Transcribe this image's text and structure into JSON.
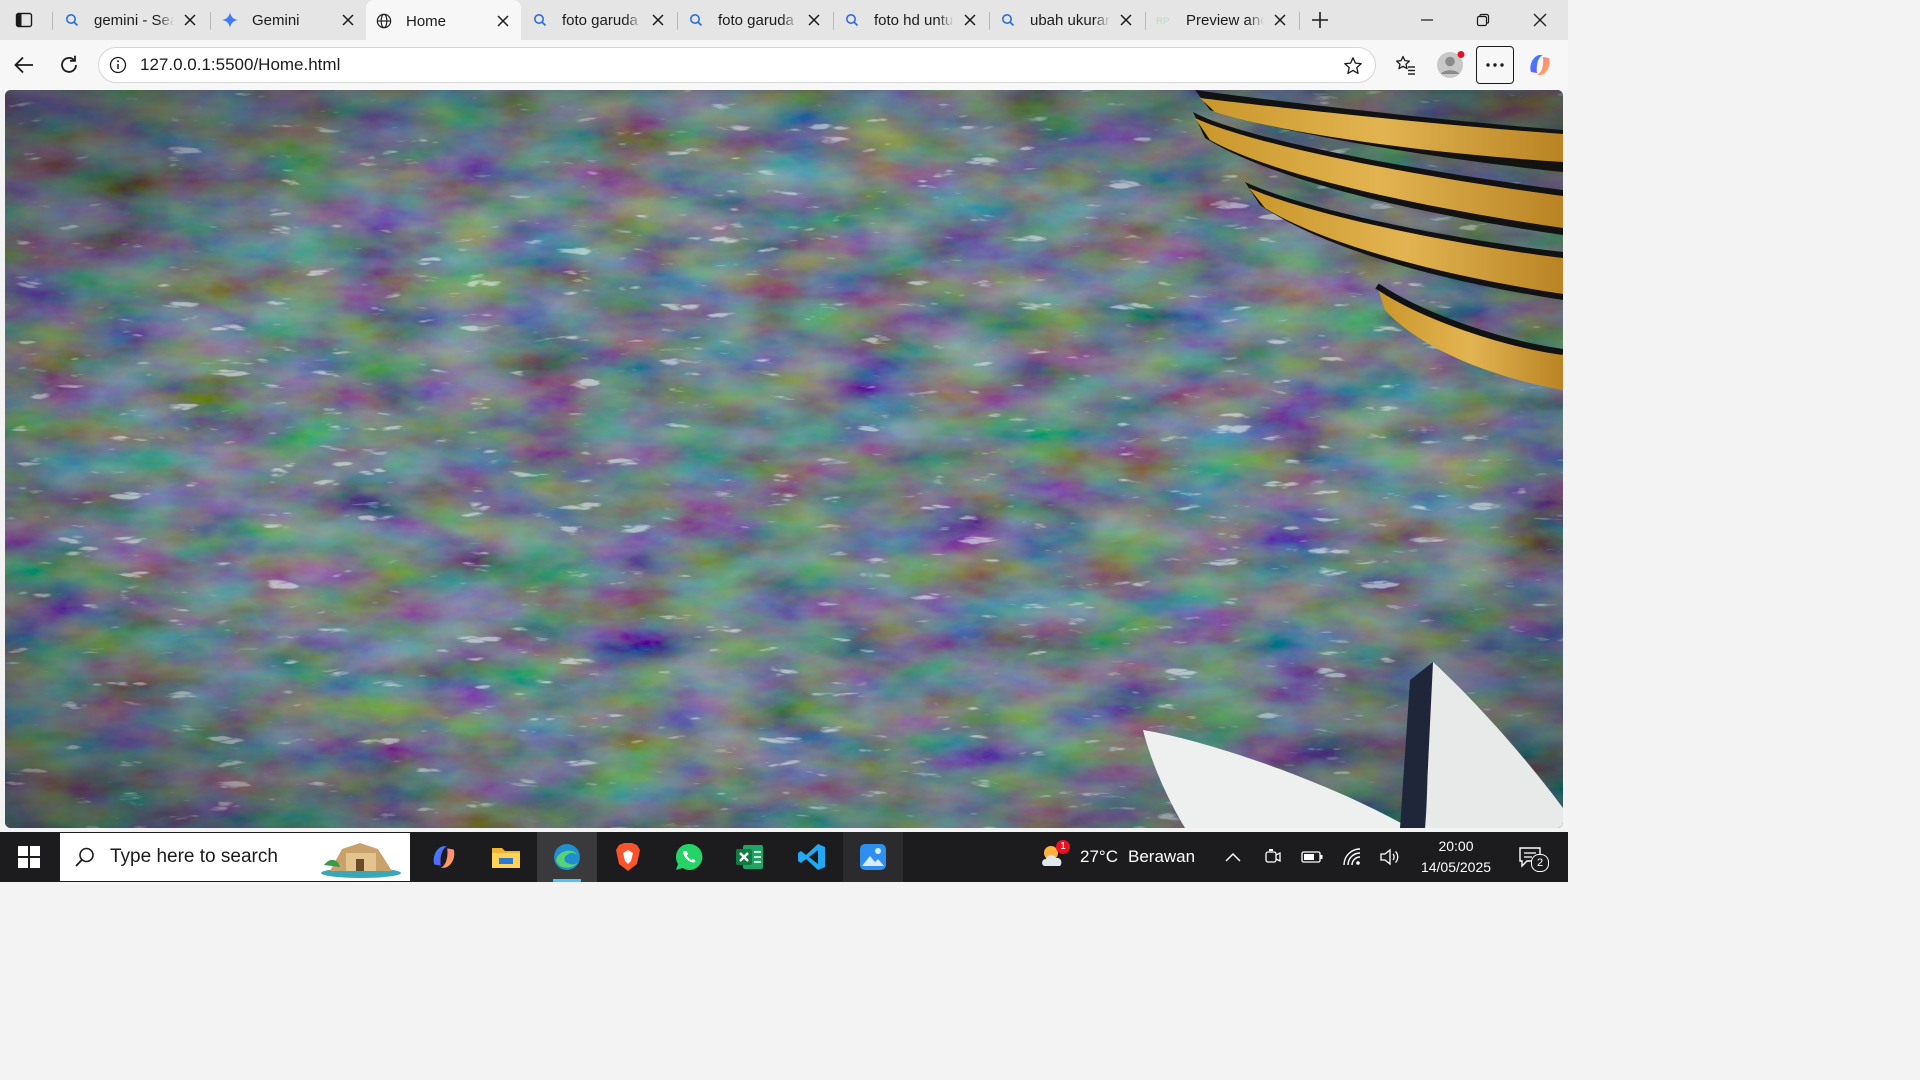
{
  "browser": {
    "tabs": [
      {
        "title": "gemini - Search",
        "icon": "search-icon",
        "active": false
      },
      {
        "title": "Gemini",
        "icon": "gemini-sparkle-icon",
        "active": false
      },
      {
        "title": "Home",
        "icon": "globe-icon",
        "active": true
      },
      {
        "title": "foto garuda",
        "icon": "search-icon",
        "active": false
      },
      {
        "title": "foto garuda",
        "icon": "search-icon",
        "active": false
      },
      {
        "title": "foto hd untuk",
        "icon": "search-icon",
        "active": false
      },
      {
        "title": "ubah ukuran",
        "icon": "search-icon",
        "active": false
      },
      {
        "title": "Preview and",
        "icon": "rp-site-icon",
        "active": false
      }
    ],
    "address": {
      "url": "127.0.0.1:5500/Home.html"
    }
  },
  "page": {
    "description_content": "Full-bleed background photo of dark rocky water with golden feather and white wing tips at right"
  },
  "taskbar": {
    "search_placeholder": "Type here to search",
    "apps": [
      {
        "name": "copilot-app-icon",
        "active": false
      },
      {
        "name": "file-explorer-icon",
        "active": false
      },
      {
        "name": "edge-browser-icon",
        "active": true
      },
      {
        "name": "brave-browser-icon",
        "active": false
      },
      {
        "name": "whatsapp-icon",
        "active": false
      },
      {
        "name": "excel-icon",
        "active": false
      },
      {
        "name": "vscode-icon",
        "active": false
      },
      {
        "name": "photos-app-icon",
        "active": false
      }
    ],
    "weather": {
      "temp": "27°C",
      "condition": "Berawan",
      "badge": "1"
    },
    "clock": {
      "time": "20:00",
      "date": "14/05/2025"
    },
    "notifications_count": "2"
  },
  "colors": {
    "accent": "#4cc2ff",
    "tabstrip": "#e5e5e5",
    "toolbar": "#f7f7f7",
    "taskbar": "#1c1c1e"
  }
}
